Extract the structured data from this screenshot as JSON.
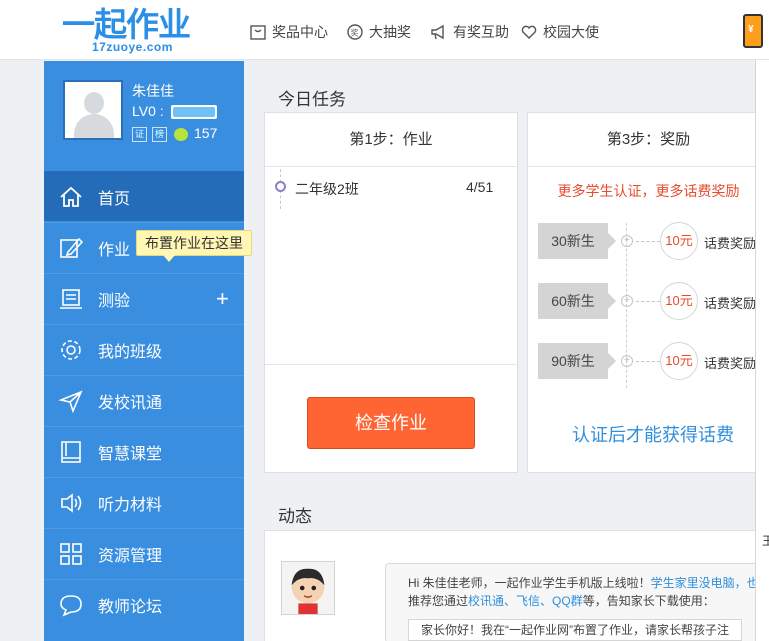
{
  "header": {
    "logo_text": "一起作业",
    "logo_sub": "17zuoye.com",
    "nav": [
      {
        "label": "奖品中心",
        "icon": "gift-icon"
      },
      {
        "label": "大抽奖",
        "icon": "lottery-icon"
      },
      {
        "label": "有奖互助",
        "icon": "megaphone-icon"
      },
      {
        "label": "校园大使",
        "icon": "heart-icon"
      }
    ]
  },
  "profile": {
    "name": "朱佳佳",
    "level": "LV0 :",
    "level_progress": 0.95,
    "badges": [
      "证",
      "榜"
    ],
    "coins": "157"
  },
  "sidebar": {
    "items": [
      {
        "label": "首页",
        "icon": "home-icon"
      },
      {
        "label": "作业",
        "icon": "pencil-icon"
      },
      {
        "label": "测验",
        "icon": "quiz-icon",
        "extra": "+"
      },
      {
        "label": "我的班级",
        "icon": "gear-icon"
      },
      {
        "label": "发校讯通",
        "icon": "send-icon"
      },
      {
        "label": "智慧课堂",
        "icon": "book-icon"
      },
      {
        "label": "听力材料",
        "icon": "speaker-icon"
      },
      {
        "label": "资源管理",
        "icon": "grid-icon"
      },
      {
        "label": "教师论坛",
        "icon": "chat-icon"
      }
    ],
    "tooltip": "布置作业在这里"
  },
  "today": {
    "title": "今日任务",
    "step1": {
      "header": "第1步：作业",
      "task_class": "二年级2班",
      "task_count": "4/51",
      "button": "检查作业"
    },
    "step3": {
      "header": "第3步：奖励",
      "hint": "更多学生认证，更多话费奖励",
      "rows": [
        {
          "step": "30新生",
          "amount": "10元",
          "label": "话费奖励"
        },
        {
          "step": "60新生",
          "amount": "10元",
          "label": "话费奖励"
        },
        {
          "step": "90新生",
          "amount": "10元",
          "label": "话费奖励"
        }
      ],
      "link": "认证后才能获得话费"
    }
  },
  "feed": {
    "title": "动态",
    "line1_a": "Hi 朱佳佳老师，一起作业学生手机版上线啦！",
    "line1_b": "学生家里没电脑，也可",
    "line2_a": "推荐您通过",
    "line2_links": "校讯通、飞信、QQ群",
    "line2_b": "等，告知家长下载使用：",
    "line3": "家长你好！我在“一起作业网”布置了作业，请家长帮孩子注"
  },
  "right_panel": {
    "text": "王"
  },
  "colors": {
    "sidebar": "#3a8ee0",
    "active": "#256cb8",
    "accent": "#ff6433",
    "link": "#2f8fdc"
  }
}
